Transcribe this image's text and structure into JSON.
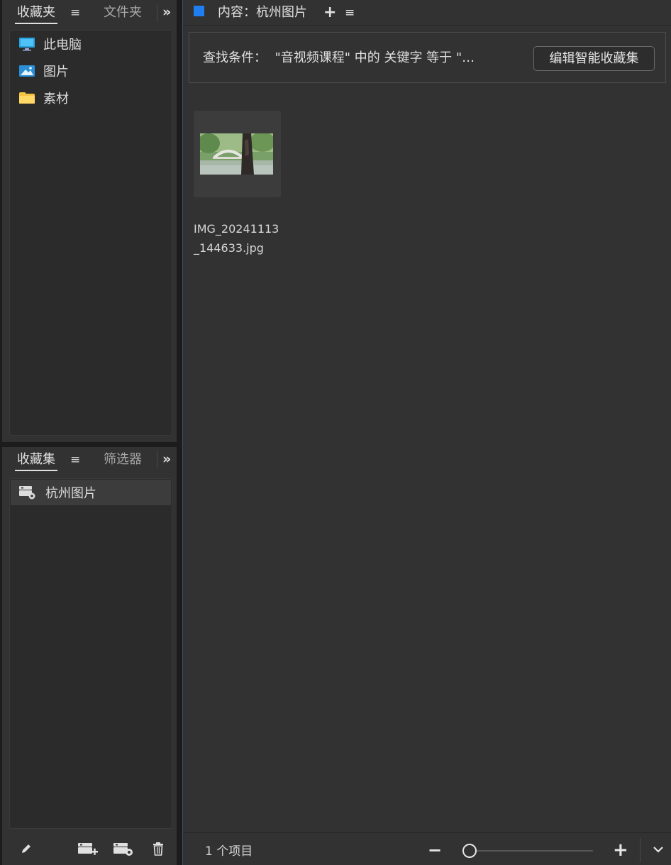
{
  "favorites_panel": {
    "tab_active": "收藏夹",
    "tab_menu": "≡",
    "tab_inactive": "文件夹",
    "more": "»",
    "items": [
      {
        "label": "此电脑",
        "icon": "computer-icon"
      },
      {
        "label": "图片",
        "icon": "pictures-icon"
      },
      {
        "label": "素材",
        "icon": "folder-icon"
      }
    ]
  },
  "collections_panel": {
    "tab_active": "收藏集",
    "tab_menu": "≡",
    "tab_inactive": "筛选器",
    "more": "»",
    "items": [
      {
        "label": "杭州图片",
        "icon": "smart-collection-icon"
      }
    ],
    "tools": [
      "edit-icon",
      "new-collection-icon",
      "new-smart-collection-icon",
      "delete-icon"
    ]
  },
  "content_panel": {
    "title": "内容：杭州图片",
    "add": "+",
    "menu": "≡",
    "search_criteria": "查找条件：  \"音视频课程\" 中的 关键字 等于 \"…",
    "edit_button": "编辑智能收藏集",
    "files": [
      {
        "name": "IMG_20241113_144633.jpg"
      }
    ],
    "item_count": "1 个项目",
    "zoom_minus": "−",
    "zoom_plus": "+",
    "zoom_level": 0
  },
  "colors": {
    "accent": "#1f7ef0",
    "panel_bg": "#323232",
    "list_bg": "#2b2b2b"
  }
}
